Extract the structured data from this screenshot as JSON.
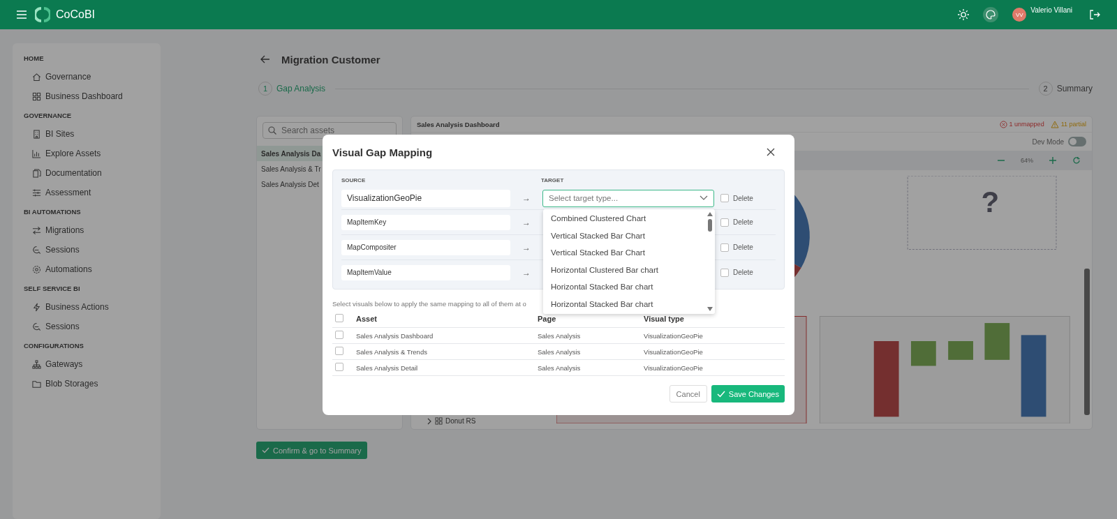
{
  "topbar": {
    "app_name": "CoCoBI",
    "avatar_initials": "VV",
    "user_name": "Valerio Villani"
  },
  "sidebar": {
    "sections": [
      {
        "title": "HOME",
        "items": [
          {
            "label": "Governance"
          },
          {
            "label": "Business Dashboard"
          }
        ]
      },
      {
        "title": "GOVERNANCE",
        "items": [
          {
            "label": "BI Sites"
          },
          {
            "label": "Explore Assets"
          },
          {
            "label": "Documentation"
          },
          {
            "label": "Assessment"
          }
        ]
      },
      {
        "title": "BI AUTOMATIONS",
        "items": [
          {
            "label": "Migrations"
          },
          {
            "label": "Sessions"
          },
          {
            "label": "Automations"
          }
        ]
      },
      {
        "title": "SELF SERVICE BI",
        "items": [
          {
            "label": "Business Actions"
          },
          {
            "label": "Sessions"
          }
        ]
      },
      {
        "title": "CONFIGURATIONS",
        "items": [
          {
            "label": "Gateways"
          },
          {
            "label": "Blob Storages"
          }
        ]
      }
    ]
  },
  "page": {
    "title": "Migration Customer",
    "steps": [
      {
        "number": "1",
        "label": "Gap Analysis",
        "selected": true
      },
      {
        "number": "2",
        "label": "Summary",
        "selected": false
      }
    ],
    "assets": {
      "placeholder": "Search assets",
      "items": [
        {
          "label": "Sales Analysis Da",
          "selected": true
        },
        {
          "label": "Sales Analysis & Tr",
          "selected": false
        },
        {
          "label": "Sales Analysis Det",
          "selected": false
        }
      ]
    },
    "preview": {
      "title": "Sales Analysis Dashboard",
      "unmapped": "1 unmapped",
      "partial": "11 partial",
      "dev_mode": {
        "label": "Dev Mode",
        "on": false
      },
      "zoom": "64%",
      "tree_item": "Donut RS",
      "unknown_mark": "?"
    },
    "confirm_button": "Confirm & go to Summary"
  },
  "dialog": {
    "title": "Visual Gap Mapping",
    "source_label": "SOURCE",
    "target_label": "TARGET",
    "mappings": [
      {
        "source": "VisualizationGeoPie",
        "arrow": "→",
        "target_placeholder": "Select target type...",
        "delete_label": "Delete",
        "delete": false
      },
      {
        "source": "MapItemKey",
        "arrow": "→",
        "delete_label": "Delete",
        "delete": false
      },
      {
        "source": "MapCompositer",
        "arrow": "→",
        "delete_label": "Delete",
        "delete": false
      },
      {
        "source": "MapItemValue",
        "arrow": "→",
        "delete_label": "Delete",
        "delete": false
      }
    ],
    "options": [
      "Combined Clustered Chart",
      "Vertical Stacked Bar Chart",
      "Vertical Stacked Bar Chart",
      "Horizontal Clustered Bar chart",
      "Horizontal Stacked Bar chart",
      "Horizontal Stacked Bar chart"
    ],
    "hint": "Select visuals below to apply the same mapping to all of them at o",
    "columns": [
      "Asset",
      "Page",
      "Visual type"
    ],
    "all_selected": false,
    "rows": [
      {
        "cells": [
          "Sales Analysis Dashboard",
          "Sales Analysis",
          "VisualizationGeoPie"
        ],
        "selected": false
      },
      {
        "cells": [
          "Sales Analysis & Trends",
          "Sales Analysis",
          "VisualizationGeoPie"
        ],
        "selected": false
      },
      {
        "cells": [
          "Sales Analysis Detail",
          "Sales Analysis",
          "VisualizationGeoPie"
        ],
        "selected": false
      }
    ],
    "cancel": "Cancel",
    "save": "Save Changes"
  }
}
